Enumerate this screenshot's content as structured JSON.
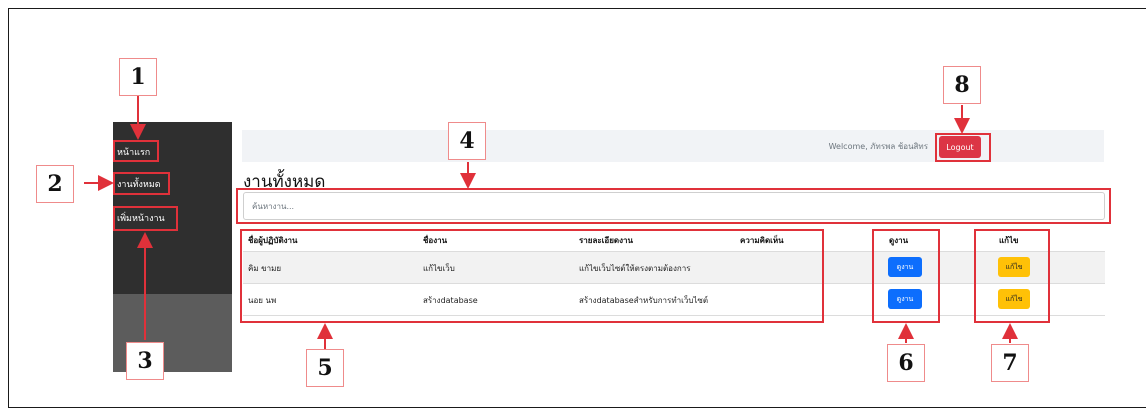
{
  "sidebar": {
    "items": [
      {
        "label": "หน้าแรก"
      },
      {
        "label": "งานทั้งหมด"
      },
      {
        "label": "เพิ่มหน้างาน"
      }
    ]
  },
  "header": {
    "welcome": "Welcome, ภัทรพล ช้อนสิทร",
    "logout_label": "Logout"
  },
  "main": {
    "title": "งานทั้งหมด",
    "search_placeholder": "ค้นหางาน...",
    "table": {
      "columns": [
        "ชื่อผู้ปฏิบัติงาน",
        "ชื่องาน",
        "รายละเอียดงาน",
        "ความคิดเห็น",
        "ดูงาน",
        "แก้ไข"
      ],
      "rows": [
        {
          "worker": "คิม ขามย",
          "task": "แก้ไขเว็บ",
          "detail": "แก้ไขเว็บไซต์ให้ตรงตามต้องการ",
          "comment": "",
          "view_label": "ดูงาน",
          "edit_label": "แก้ไข"
        },
        {
          "worker": "นอย นพ",
          "task": "สร้างdatabase",
          "detail": "สร้างdatabaseสำหรับการทำเว็บไซต์",
          "comment": "",
          "view_label": "ดูงาน",
          "edit_label": "แก้ไข"
        }
      ]
    }
  },
  "annotations": {
    "callouts": [
      "1",
      "2",
      "3",
      "4",
      "5",
      "6",
      "7",
      "8"
    ],
    "highlight_color": "#e0313a"
  },
  "colors": {
    "sidebar_bg": "#2f2f2f",
    "logout_bg": "#dc3545",
    "view_btn_bg": "#0d6efd",
    "edit_btn_bg": "#ffc107"
  }
}
